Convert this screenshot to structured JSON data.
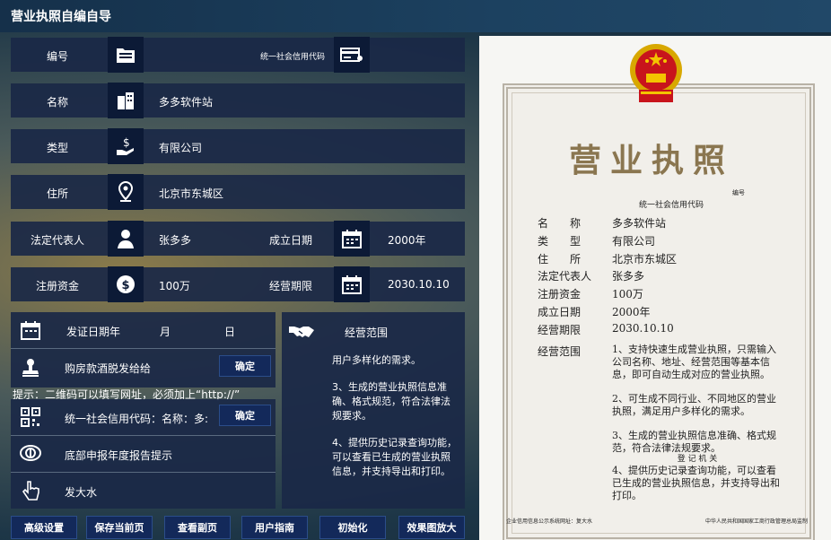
{
  "app_title": "营业执照自编自导",
  "form": {
    "code_label": "编号",
    "credit_code_label": "统一社会信用代码",
    "name_label": "名称",
    "name_value": "多多软件站",
    "type_label": "类型",
    "type_value": "有限公司",
    "address_label": "住所",
    "address_value": "北京市东城区",
    "legal_rep_label": "法定代表人",
    "legal_rep_value": "张多多",
    "found_date_label": "成立日期",
    "found_date_value": "2000年",
    "capital_label": "注册资金",
    "capital_value": "100万",
    "term_label": "经营期限",
    "term_value": "2030.10.10"
  },
  "lower": {
    "issue_date_label": "发证日期年",
    "month_label": "月",
    "day_label": "日",
    "scope_label": "经营范围",
    "stamp_text": "购房款酒脱发给给",
    "confirm_1": "确定",
    "hint": "提示：二维码可以填写网址，必须加上“http://”",
    "qr_text": "统一社会信用代码：名称：多:",
    "confirm_2": "确定",
    "annual_text": "底部申报年度报告提示",
    "hand_text": "发大水",
    "scope_text": [
      "用户多样化的需求。",
      "3、生成的营业执照信息准确、格式规范，符合法律法规要求。",
      "4、提供历史记录查询功能，可以查看已生成的营业执照信息，并支持导出和打印。"
    ]
  },
  "buttons": [
    "高级设置",
    "保存当前页",
    "查看副页",
    "用户指南",
    "初始化",
    "效果图放大"
  ],
  "certificate": {
    "title": "营业执照",
    "code_small": "编号",
    "credit_label": "统一社会信用代码",
    "fields": [
      {
        "label": "名　　称",
        "value": "多多软件站"
      },
      {
        "label": "类　　型",
        "value": "有限公司"
      },
      {
        "label": "住　　所",
        "value": "北京市东城区"
      },
      {
        "label": "法定代表人",
        "value": "张多多"
      },
      {
        "label": "注册资金",
        "value": "100万"
      },
      {
        "label": "成立日期",
        "value": "2000年"
      },
      {
        "label": "经营期限",
        "value": "2030.10.10"
      }
    ],
    "scope_label": "经营范围",
    "scope_paras": [
      "1、支持快速生成营业执照，只需输入公司名称、地址、经营范围等基本信息，即可自动生成对应的营业执照。",
      "2、可生成不同行业、不同地区的营业执照，满足用户多样化的需求。",
      "3、生成的营业执照信息准确、格式规范，符合法律法规要求。",
      "4、提供历史记录查询功能，可以查看已生成的营业执照信息，并支持导出和打印。"
    ],
    "reg_office": "登 记 机 关",
    "footer_left": "企业信用信息公示系统网址：复大水",
    "footer_right": "中华人民共和国国家工商行政管理总局监制"
  }
}
